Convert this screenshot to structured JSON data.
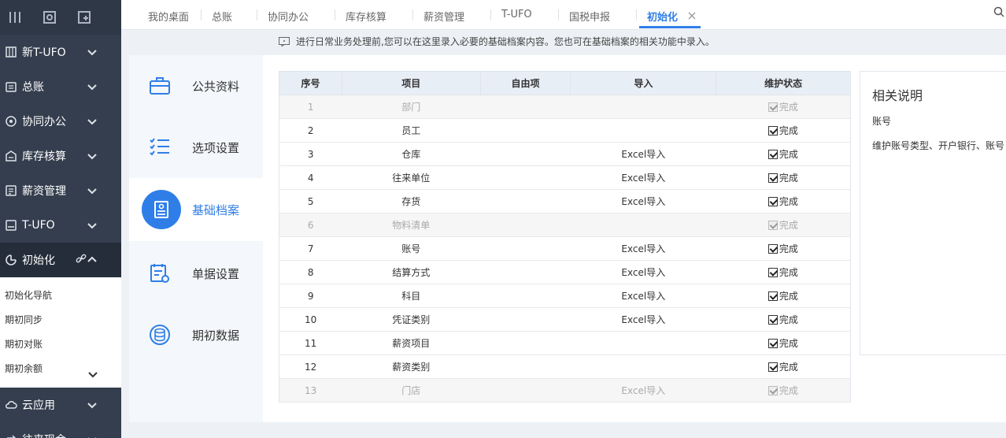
{
  "sidebar": {
    "top_icons": [
      "menu-icon",
      "monitor-icon",
      "export-icon"
    ],
    "items": [
      {
        "label": "新T-UFO",
        "icon": "report-icon"
      },
      {
        "label": "总账",
        "icon": "ledger-icon"
      },
      {
        "label": "协同办公",
        "icon": "collab-icon"
      },
      {
        "label": "库存核算",
        "icon": "inventory-icon"
      },
      {
        "label": "薪资管理",
        "icon": "salary-icon"
      },
      {
        "label": "T-UFO",
        "icon": "ufo-icon"
      },
      {
        "label": "初始化",
        "icon": "init-icon"
      }
    ],
    "submenu": [
      "初始化导航",
      "期初同步",
      "期初对账",
      "期初余额"
    ],
    "bottom_items": [
      {
        "label": "云应用",
        "icon": "cloud-icon"
      },
      {
        "label": "往来现金",
        "icon": "exchange-icon"
      }
    ]
  },
  "tabs": [
    "我的桌面",
    "总账",
    "协同办公",
    "库存核算",
    "薪资管理",
    "T-UFO",
    "国税申报",
    "初始化"
  ],
  "active_tab": "初始化",
  "notice": "进行日常业务处理前,您可以在这里录入必要的基础档案内容。您也可在基础档案的相关功能中录入。",
  "panel": [
    "公共资料",
    "选项设置",
    "基础档案",
    "单据设置",
    "期初数据"
  ],
  "active_panel": "基础档案",
  "table": {
    "headers": [
      "序号",
      "项目",
      "自由项",
      "导入",
      "维护状态"
    ],
    "rows": [
      {
        "no": "1",
        "item": "部门",
        "free": "",
        "import": "",
        "status": "完成",
        "disabled": true
      },
      {
        "no": "2",
        "item": "员工",
        "free": "",
        "import": "",
        "status": "完成",
        "disabled": false
      },
      {
        "no": "3",
        "item": "仓库",
        "free": "",
        "import": "Excel导入",
        "status": "完成",
        "disabled": false
      },
      {
        "no": "4",
        "item": "往来单位",
        "free": "",
        "import": "Excel导入",
        "status": "完成",
        "disabled": false
      },
      {
        "no": "5",
        "item": "存货",
        "free": "",
        "import": "Excel导入",
        "status": "完成",
        "disabled": false
      },
      {
        "no": "6",
        "item": "物料清单",
        "free": "",
        "import": "",
        "status": "完成",
        "disabled": true
      },
      {
        "no": "7",
        "item": "账号",
        "free": "",
        "import": "Excel导入",
        "status": "完成",
        "disabled": false
      },
      {
        "no": "8",
        "item": "结算方式",
        "free": "",
        "import": "Excel导入",
        "status": "完成",
        "disabled": false
      },
      {
        "no": "9",
        "item": "科目",
        "free": "",
        "import": "Excel导入",
        "status": "完成",
        "disabled": false
      },
      {
        "no": "10",
        "item": "凭证类别",
        "free": "",
        "import": "Excel导入",
        "status": "完成",
        "disabled": false
      },
      {
        "no": "11",
        "item": "薪资项目",
        "free": "",
        "import": "",
        "status": "完成",
        "disabled": false
      },
      {
        "no": "12",
        "item": "薪资类别",
        "free": "",
        "import": "",
        "status": "完成",
        "disabled": false
      },
      {
        "no": "13",
        "item": "门店",
        "free": "",
        "import": "Excel导入",
        "status": "完成",
        "disabled": true
      }
    ]
  },
  "help": {
    "title": "相关说明",
    "subtitle": "账号",
    "description": "维护账号类型、开户银行、账号"
  },
  "colors": {
    "accent": "#2f7ee8",
    "sidebar": "#343e4e"
  }
}
